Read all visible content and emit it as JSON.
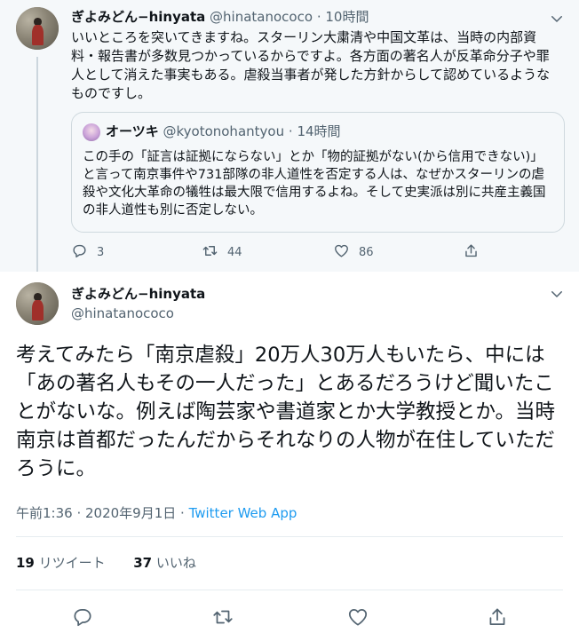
{
  "parent_tweet": {
    "display_name": "ぎよみどん−hinyata",
    "handle": "@hinatanococo",
    "separator": "·",
    "time": "10時間",
    "text": "いいところを突いてきますね。スターリン大粛清や中国文革は、当時の内部資料・報告書が多数見つかっているからですよ。各方面の著名人が反革命分子や罪人として消えた事実もある。虐殺当事者が発した方針からして認めているようなものですし。",
    "quoted": {
      "display_name": "オーツキ",
      "handle": "@kyotonohantyou",
      "separator": "·",
      "time": "14時間",
      "text": "この手の「証言は証拠にならない」とか「物的証拠がない(から信用できない)」と言って南京事件や731部隊の非人道性を否定する人は、なぜかスターリンの虐殺や文化大革命の犠牲は最大限で信用するよね。そして史実派は別に共産主義国の非人道性も別に否定しない。"
    },
    "actions": {
      "reply_count": "3",
      "retweet_count": "44",
      "like_count": "86"
    }
  },
  "main_tweet": {
    "display_name": "ぎよみどん−hinyata",
    "handle": "@hinatanococo",
    "text": "考えてみたら「南京虐殺」20万人30万人もいたら、中には「あの著名人もその一人だった」とあるだろうけど聞いたことがないな。例えば陶芸家や書道家とか大学教授とか。当時南京は首都だったんだからそれなりの人物が在住していただろうに。",
    "timestamp": "午前1:36 · 2020年9月1日 · ",
    "source": "Twitter Web App",
    "retweets_count": "19",
    "retweets_label": "リツイート",
    "likes_count": "37",
    "likes_label": "いいね"
  },
  "icons": [
    "chevron-down-icon",
    "reply-icon",
    "retweet-icon",
    "like-icon",
    "share-icon"
  ],
  "colors": {
    "parent_background": "#f5f8fa",
    "muted_text": "#536471",
    "link": "#1d9bf0",
    "border": "#cfd9de"
  }
}
